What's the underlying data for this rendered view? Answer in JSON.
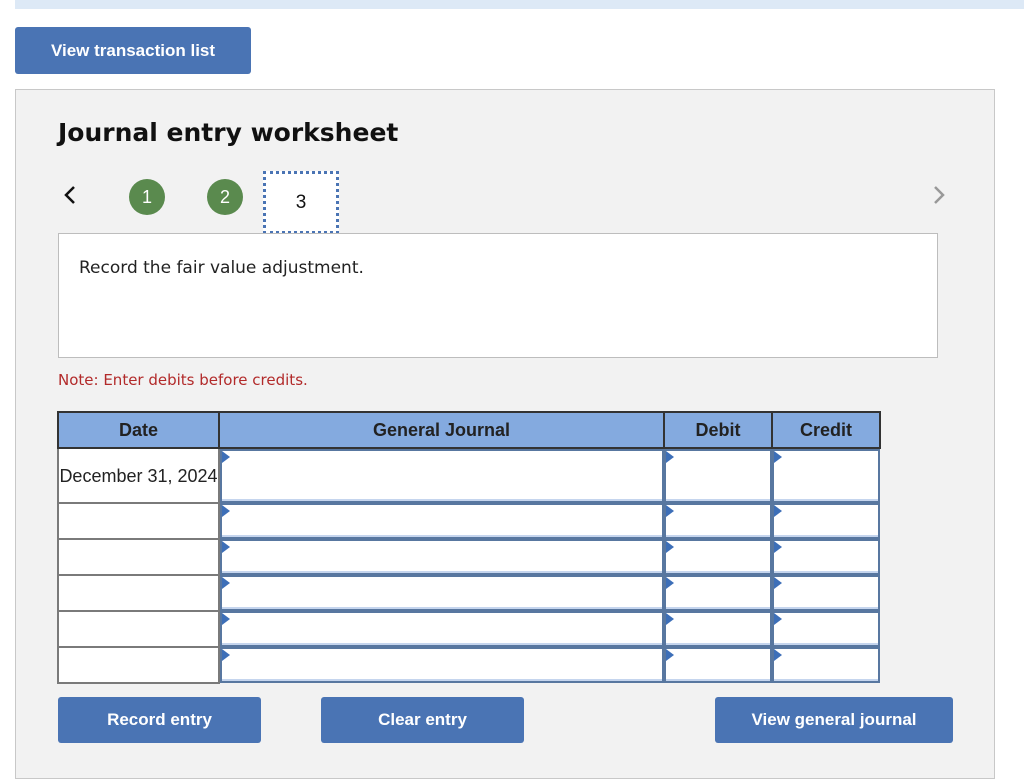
{
  "header": {
    "view_transactions_label": "View transaction list"
  },
  "worksheet": {
    "title": "Journal entry worksheet",
    "steps": [
      {
        "label": "1",
        "status": "complete"
      },
      {
        "label": "2",
        "status": "complete"
      },
      {
        "label": "3",
        "status": "current"
      }
    ],
    "instruction": "Record the fair value adjustment.",
    "note": "Note: Enter debits before credits.",
    "colors": {
      "accent": "#4a74b4",
      "step_complete": "#5a8a4e",
      "table_header": "#84aadf",
      "note": "#b22a2a"
    }
  },
  "table": {
    "headers": {
      "date": "Date",
      "general_journal": "General Journal",
      "debit": "Debit",
      "credit": "Credit"
    },
    "rows": [
      {
        "date": "December 31, 2024",
        "account": "",
        "debit": "",
        "credit": ""
      },
      {
        "date": "",
        "account": "",
        "debit": "",
        "credit": ""
      },
      {
        "date": "",
        "account": "",
        "debit": "",
        "credit": ""
      },
      {
        "date": "",
        "account": "",
        "debit": "",
        "credit": ""
      },
      {
        "date": "",
        "account": "",
        "debit": "",
        "credit": ""
      },
      {
        "date": "",
        "account": "",
        "debit": "",
        "credit": ""
      }
    ]
  },
  "actions": {
    "record_entry": "Record entry",
    "clear_entry": "Clear entry",
    "view_general_journal": "View general journal"
  }
}
